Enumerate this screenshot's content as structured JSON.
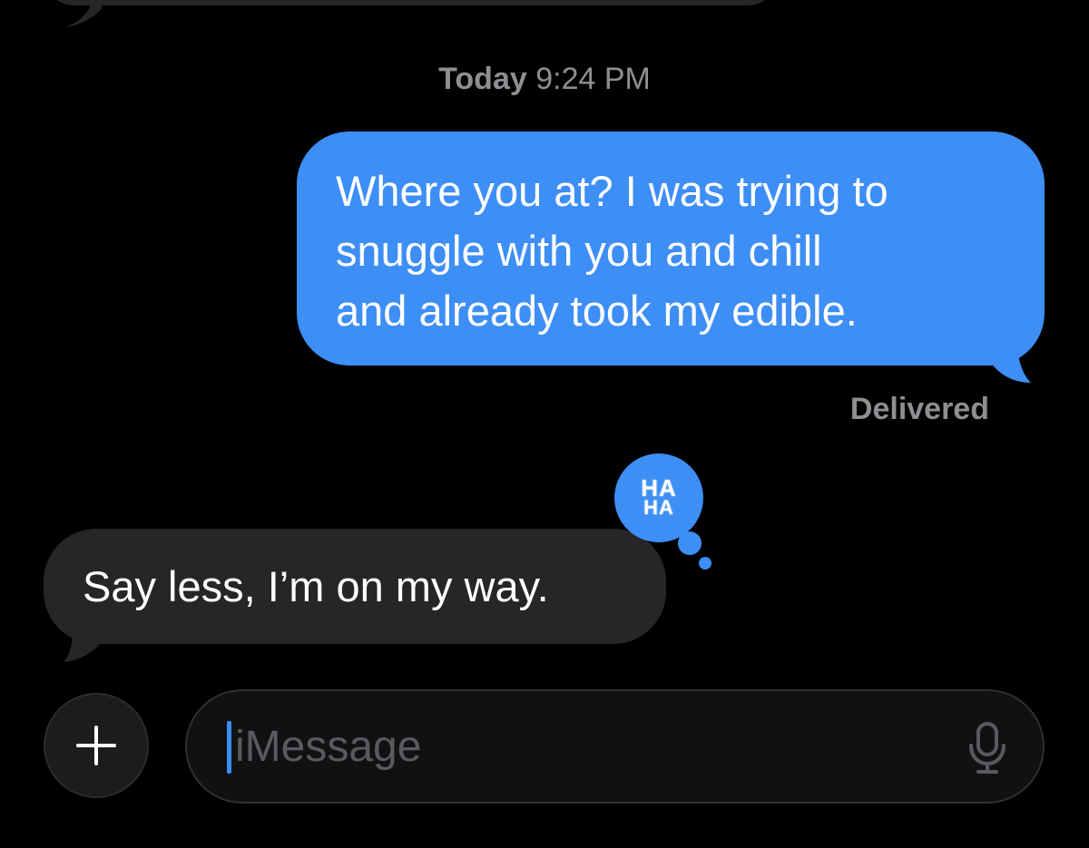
{
  "conversation": {
    "timestamp_day": "Today",
    "timestamp_time": "9:24 PM",
    "outgoing_message": "Where you at? I was trying to\nsnuggle with you and chill\nand already took my edible.",
    "status": "Delivered",
    "incoming_message": "Say less, I’m on my way.",
    "tapback": {
      "line1": "HA",
      "line2": "HA"
    }
  },
  "composer": {
    "placeholder": "iMessage",
    "plus_icon": "plus-icon",
    "mic_icon": "microphone-icon"
  },
  "colors": {
    "outgoing_bubble": "#3d8ef5",
    "incoming_bubble": "#262628",
    "background": "#000000",
    "meta_text": "#8e8e93"
  }
}
